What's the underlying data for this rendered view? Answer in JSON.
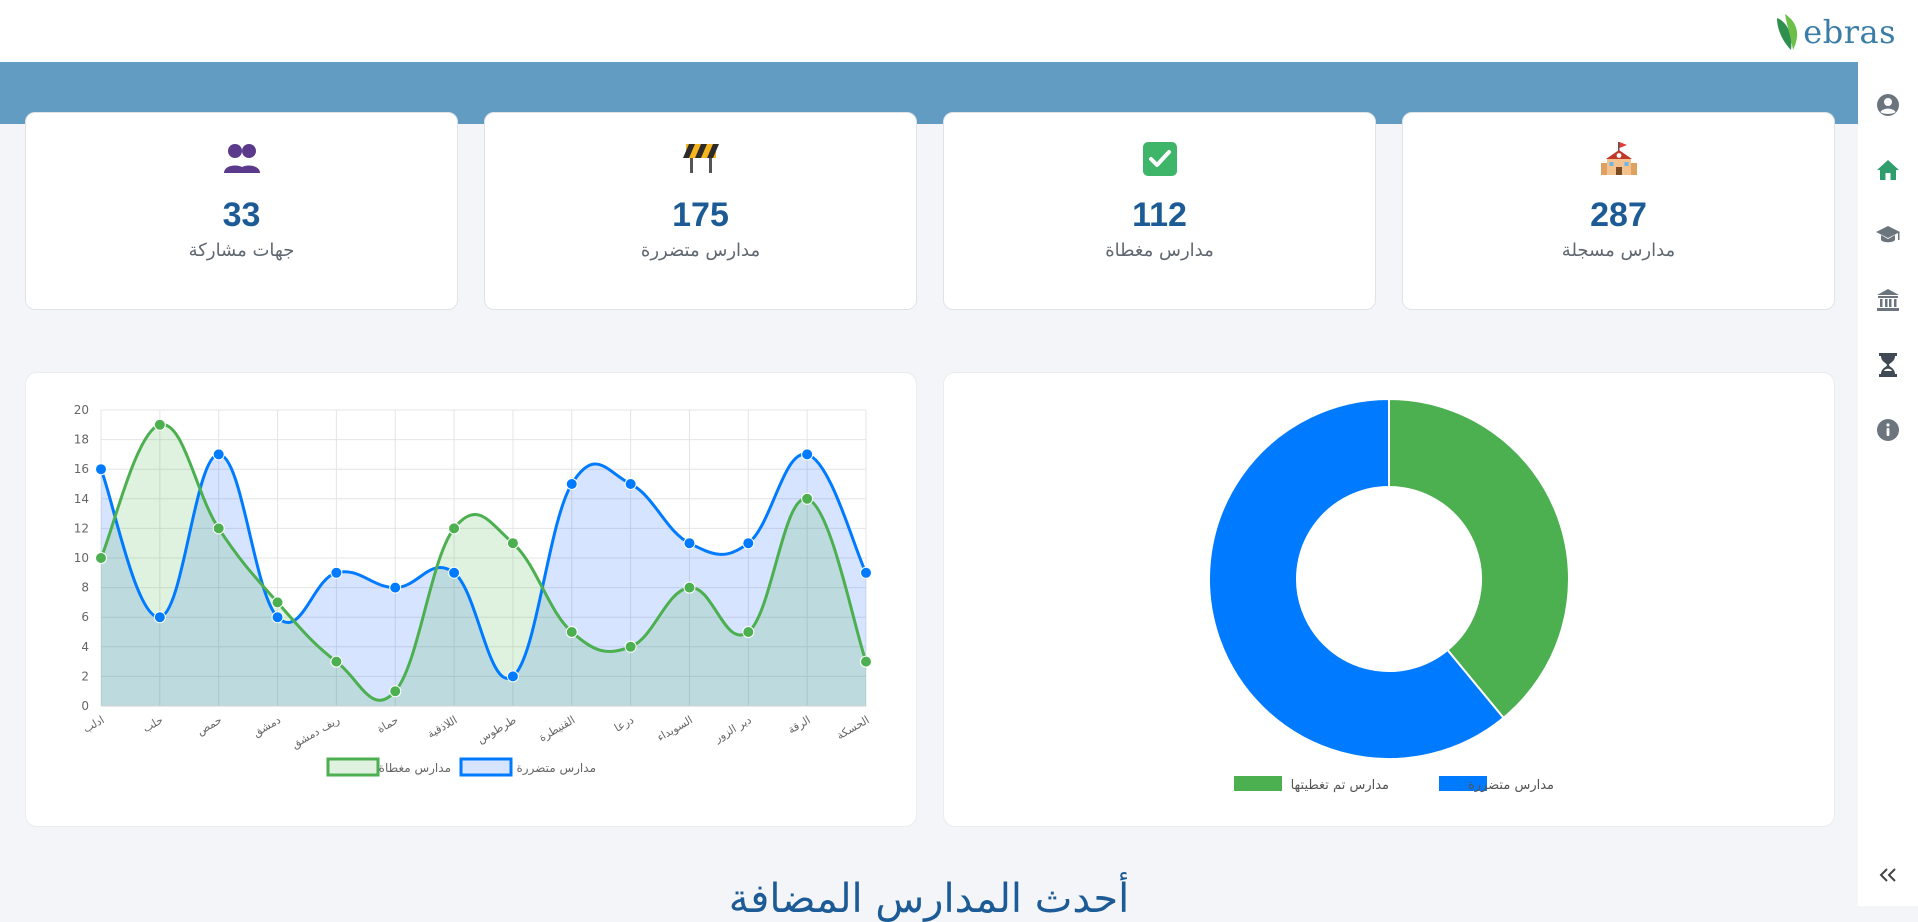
{
  "header": {
    "logo_text": "ebras"
  },
  "sidebar": {
    "items": [
      {
        "icon": "user-circle-icon",
        "name": "profile"
      },
      {
        "icon": "home-icon",
        "name": "home"
      },
      {
        "icon": "graduation-cap-icon",
        "name": "schools"
      },
      {
        "icon": "bank-icon",
        "name": "institutions"
      },
      {
        "icon": "hourglass-icon",
        "name": "pending"
      },
      {
        "icon": "info-icon",
        "name": "about"
      }
    ],
    "collapse_icon": "double-chevron-left-icon"
  },
  "stats": [
    {
      "value": "287",
      "label": "مدارس مسجلة",
      "icon": "school-icon"
    },
    {
      "value": "112",
      "label": "مدارس مغطاة",
      "icon": "check-icon"
    },
    {
      "value": "175",
      "label": "مدارس متضررة",
      "icon": "construction-icon"
    },
    {
      "value": "33",
      "label": "جهات مشاركة",
      "icon": "people-icon"
    }
  ],
  "colors": {
    "primary": "#1c5b96",
    "banner": "#639cc3",
    "green": "#4caf50",
    "blue": "#007bff"
  },
  "chart_data": [
    {
      "type": "line",
      "categories": [
        "ادلب",
        "حلب",
        "حمص",
        "دمشق",
        "ريف دمشق",
        "حماة",
        "اللاذقية",
        "طرطوس",
        "القنيطرة",
        "درعا",
        "السويداء",
        "دير الزور",
        "الرقة",
        "الحسكة"
      ],
      "series": [
        {
          "name": "مدارس مغطاة",
          "color": "#4caf50",
          "fill": "rgba(76,175,80,0.18)",
          "values": [
            10,
            19,
            12,
            7,
            3,
            1,
            12,
            11,
            5,
            4,
            8,
            5,
            14,
            3
          ]
        },
        {
          "name": "مدارس متضررة",
          "color": "#007bff",
          "fill": "rgba(0,90,255,0.16)",
          "values": [
            16,
            6,
            17,
            6,
            9,
            8,
            9,
            2,
            15,
            15,
            11,
            11,
            17,
            9
          ]
        }
      ],
      "ylim": [
        0,
        20
      ],
      "yticks": [
        0,
        2,
        4,
        6,
        8,
        10,
        12,
        14,
        16,
        18,
        20
      ],
      "grid": true,
      "legend": "bottom"
    },
    {
      "type": "pie",
      "donut": true,
      "labels": [
        "مدارس تم تغطيتها",
        "مدارس متضررة"
      ],
      "values": [
        112,
        175
      ],
      "colors": [
        "#4caf50",
        "#007bff"
      ],
      "legend": "bottom"
    }
  ],
  "section": {
    "title": "أحدث المدارس المضافة"
  }
}
